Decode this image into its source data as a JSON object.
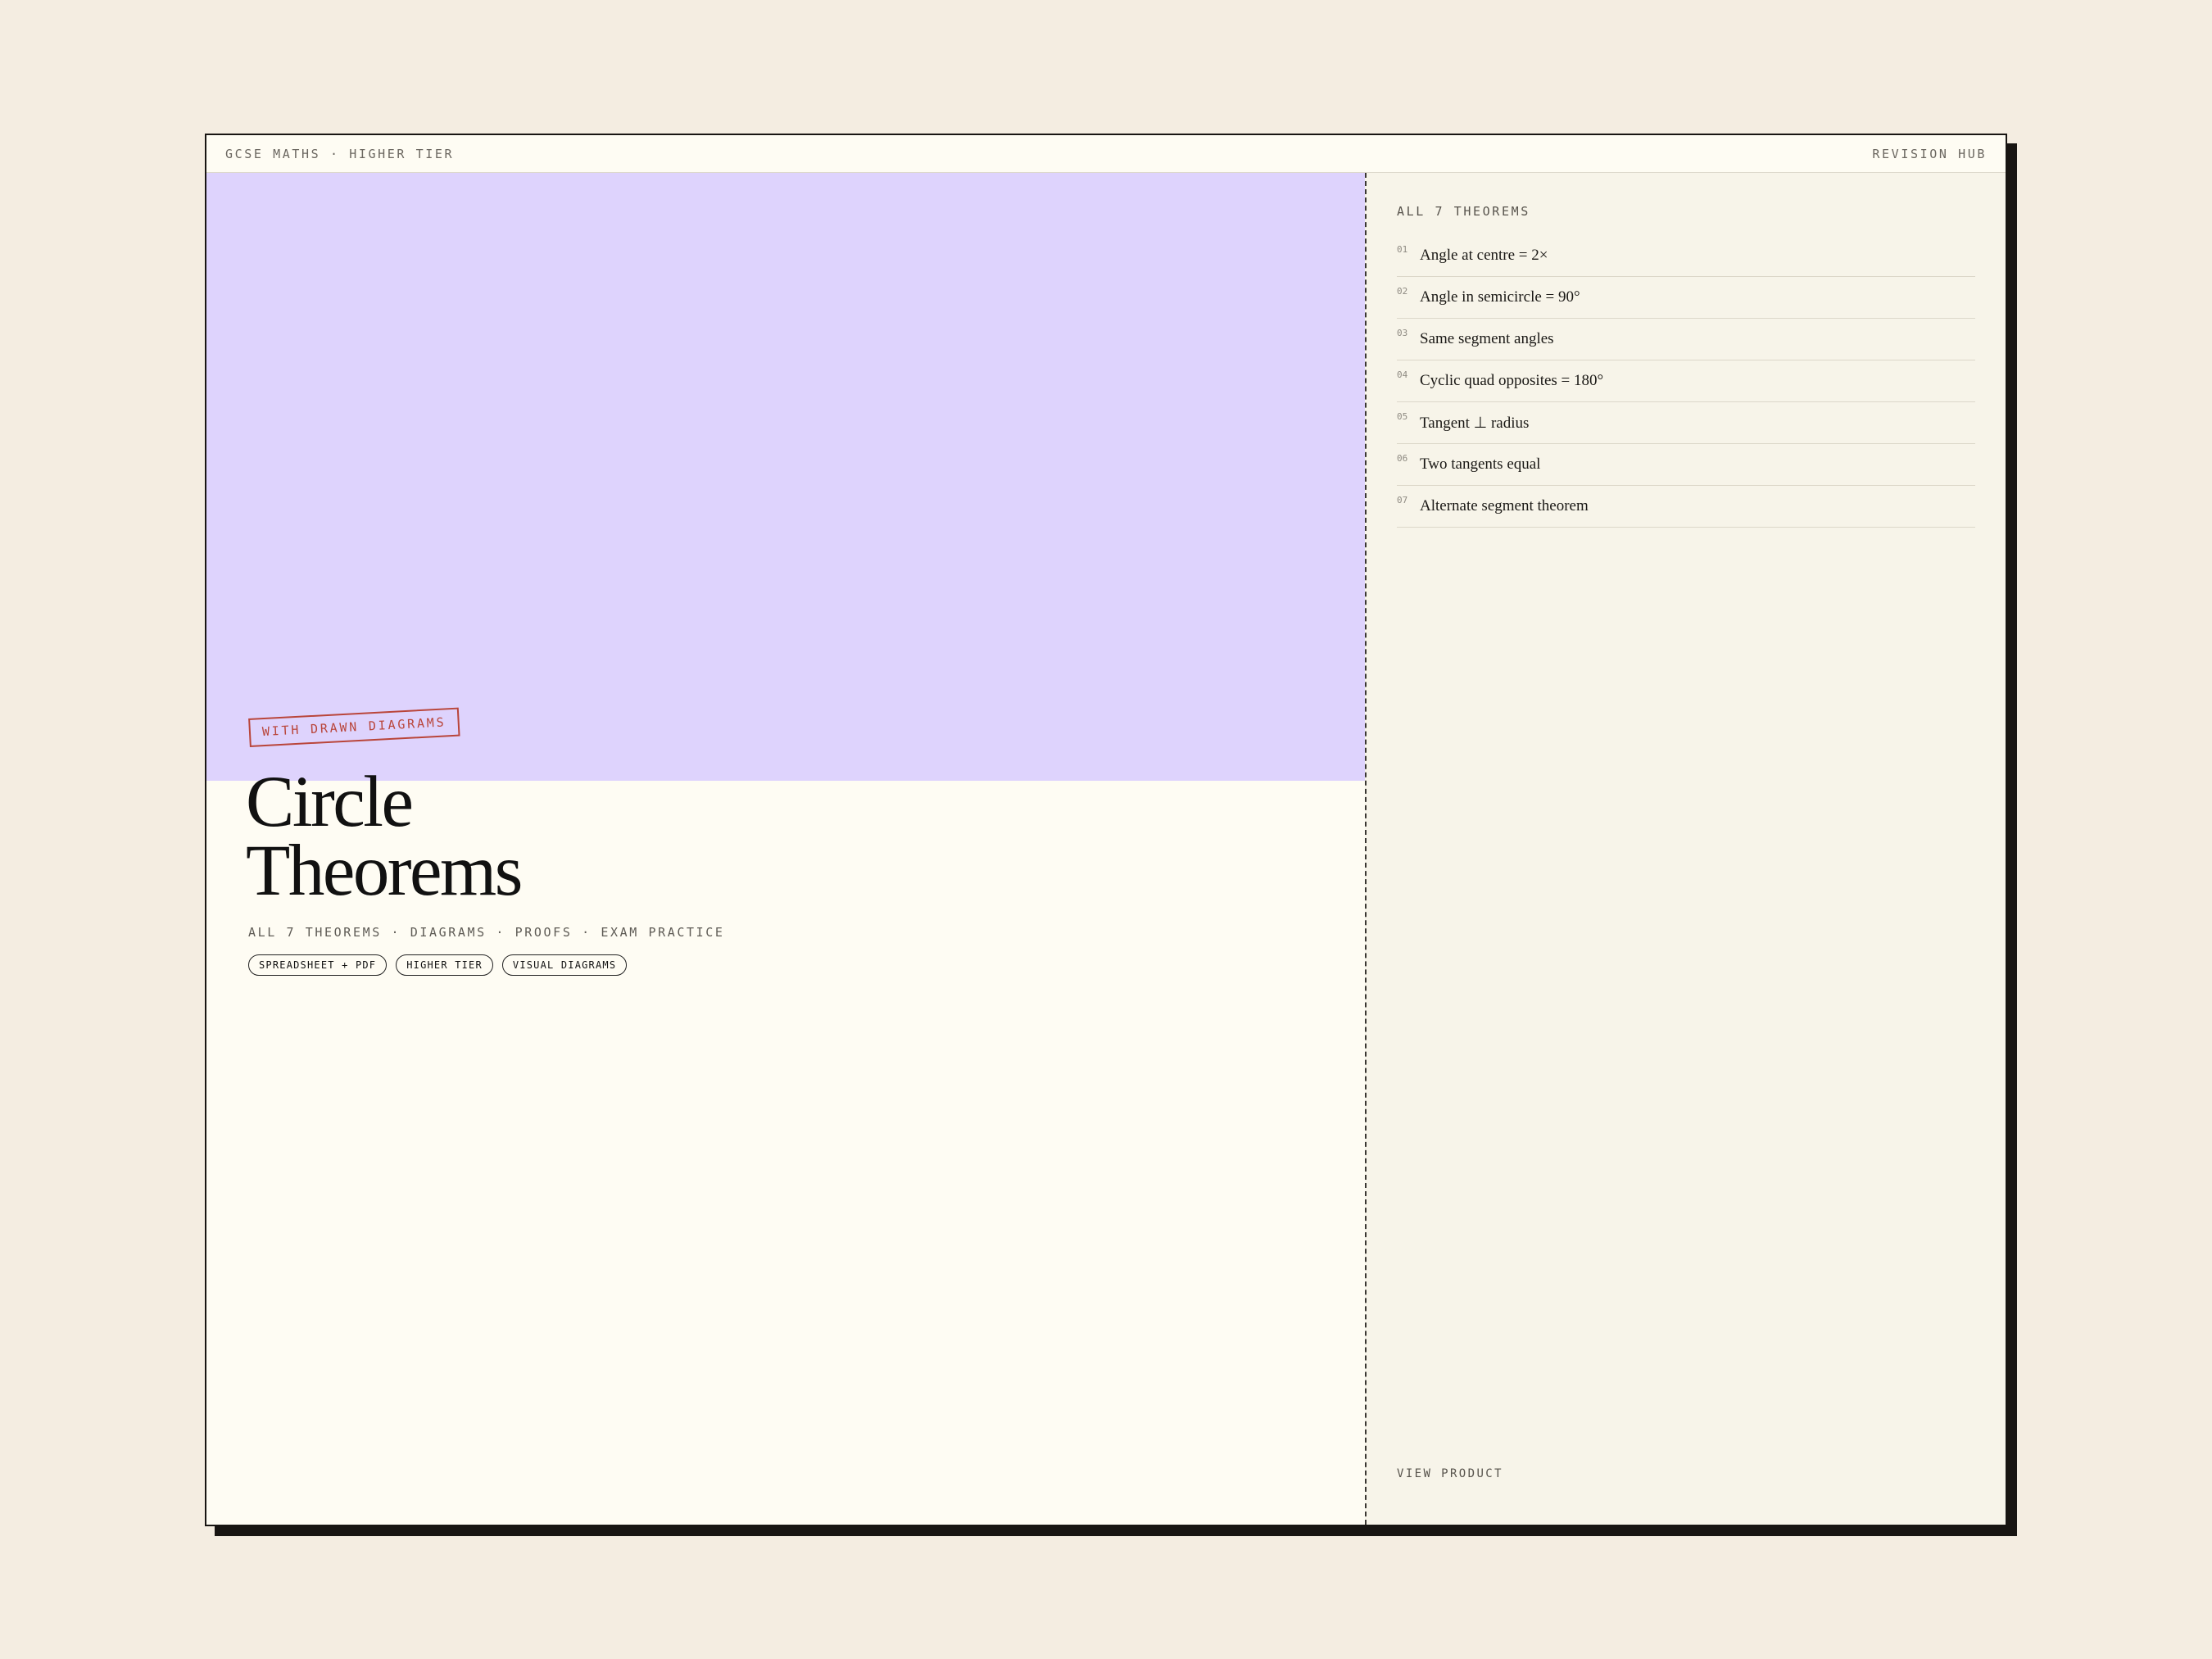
{
  "header": {
    "left": "GCSE MATHS · HIGHER TIER",
    "right": "REVISION HUB"
  },
  "hero": {
    "stamp": "WITH DRAWN DIAGRAMS",
    "title_line1": "Circle",
    "title_line2": "Theorems",
    "subtitle": "ALL 7 THEOREMS · DIAGRAMS · PROOFS · EXAM PRACTICE",
    "tags": [
      "SPREADSHEET + PDF",
      "HIGHER TIER",
      "VISUAL DIAGRAMS"
    ],
    "background_color": "#ded3fd"
  },
  "sidebar": {
    "heading": "ALL 7 THEOREMS",
    "theorems": [
      {
        "num": "01",
        "label": "Angle at centre = 2×"
      },
      {
        "num": "02",
        "label": "Angle in semicircle = 90°"
      },
      {
        "num": "03",
        "label": "Same segment angles"
      },
      {
        "num": "04",
        "label": "Cyclic quad opposites = 180°"
      },
      {
        "num": "05",
        "label": "Tangent ⊥ radius"
      },
      {
        "num": "06",
        "label": "Two tangents equal"
      },
      {
        "num": "07",
        "label": "Alternate segment theorem"
      }
    ],
    "cta": "VIEW PRODUCT",
    "cta_icon": "arrow-up-right-icon"
  },
  "colors": {
    "page_bg": "#f4ede1",
    "card_bg": "#fefcf3",
    "stamp": "#b9453a",
    "ink": "#181512"
  }
}
